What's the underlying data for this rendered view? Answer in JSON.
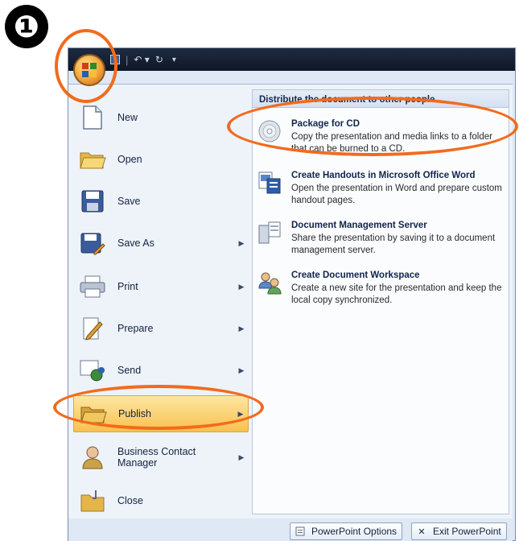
{
  "step_badge": "❶",
  "menu": {
    "items": [
      {
        "label": "New",
        "icon": "new-document-icon",
        "has_submenu": false
      },
      {
        "label": "Open",
        "icon": "folder-open-icon",
        "has_submenu": false
      },
      {
        "label": "Save",
        "icon": "floppy-disk-icon",
        "has_submenu": false
      },
      {
        "label": "Save As",
        "icon": "save-as-icon",
        "has_submenu": true
      },
      {
        "label": "Print",
        "icon": "printer-icon",
        "has_submenu": true
      },
      {
        "label": "Prepare",
        "icon": "prepare-icon",
        "has_submenu": true
      },
      {
        "label": "Send",
        "icon": "send-icon",
        "has_submenu": true
      },
      {
        "label": "Publish",
        "icon": "publish-folder-icon",
        "has_submenu": true,
        "active": true
      },
      {
        "label": "Business Contact Manager",
        "icon": "contact-person-icon",
        "has_submenu": true
      },
      {
        "label": "Close",
        "icon": "close-folder-icon",
        "has_submenu": false
      }
    ]
  },
  "publish_pane": {
    "header": "Distribute the document to other people",
    "items": [
      {
        "title": "Package for CD",
        "description": "Copy the presentation and media links to a folder that can be burned to a CD.",
        "icon": "cd-disc-icon"
      },
      {
        "title": "Create Handouts in Microsoft Office Word",
        "description": "Open the presentation in Word and prepare custom handout pages.",
        "icon": "word-handouts-icon"
      },
      {
        "title": "Document Management Server",
        "description": "Share the presentation by saving it to a document management server.",
        "icon": "document-server-icon"
      },
      {
        "title": "Create Document Workspace",
        "description": "Create a new site for the presentation and keep the local copy synchronized.",
        "icon": "workspace-people-icon"
      }
    ]
  },
  "footer": {
    "options_label": "PowerPoint Options",
    "exit_label": "Exit PowerPoint"
  },
  "colors": {
    "callout": "#f26b1d",
    "active_item": "#f8c14e",
    "titlebar": "#1e2b40"
  }
}
